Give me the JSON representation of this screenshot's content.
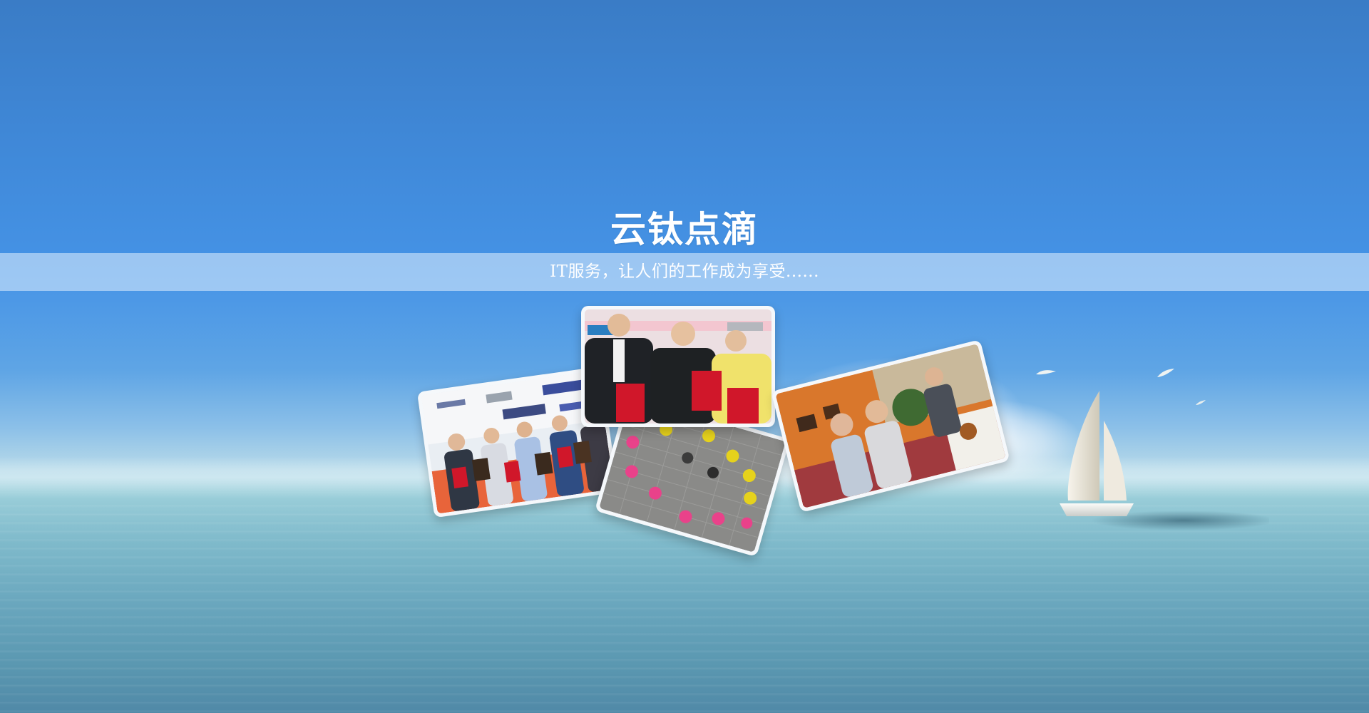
{
  "brand": {
    "logo_text": "云钛点滴",
    "tagline": "IT服务，让人们的工作成为享受......"
  },
  "photos": [
    {
      "name": "award-ceremony-group",
      "icon": "photo-certificates"
    },
    {
      "name": "award-three-people",
      "icon": "photo-certificates"
    },
    {
      "name": "team-activity-courtyard",
      "icon": "photo-team"
    },
    {
      "name": "birthday-party",
      "icon": "photo-party"
    }
  ],
  "colors": {
    "sky_top": "#3a7cc6",
    "sky_mid": "#4593e6",
    "sea": "#69a6bd",
    "certificate_red": "#d0172a",
    "shirt_yellow": "#e6d21c",
    "shirt_pink": "#e9428a"
  }
}
